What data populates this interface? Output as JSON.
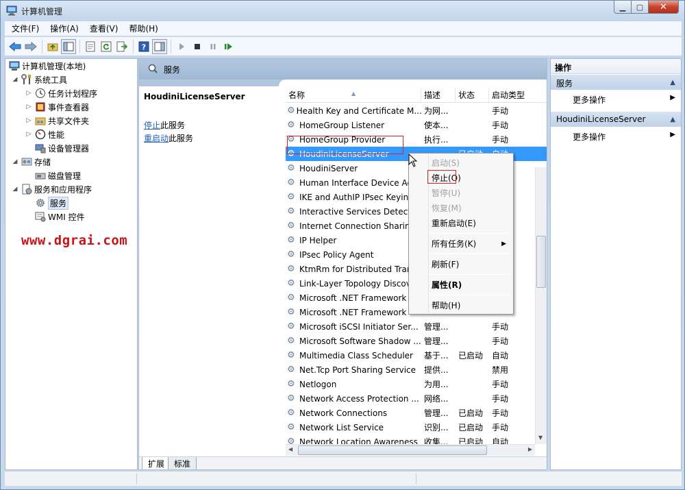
{
  "window": {
    "title": "计算机管理"
  },
  "menu": [
    "文件(F)",
    "操作(A)",
    "查看(V)",
    "帮助(H)"
  ],
  "tree": {
    "root": "计算机管理(本地)",
    "items": [
      {
        "label": "系统工具",
        "level": 1,
        "icon": "tools-icon"
      },
      {
        "label": "任务计划程序",
        "level": 2,
        "icon": "clock-icon"
      },
      {
        "label": "事件查看器",
        "level": 2,
        "icon": "event-viewer-icon"
      },
      {
        "label": "共享文件夹",
        "level": 2,
        "icon": "shared-folder-icon"
      },
      {
        "label": "性能",
        "level": 2,
        "icon": "performance-icon"
      },
      {
        "label": "设备管理器",
        "level": 2,
        "icon": "device-manager-icon"
      },
      {
        "label": "存储",
        "level": 1,
        "icon": "storage-icon"
      },
      {
        "label": "磁盘管理",
        "level": 2,
        "icon": "disk-icon"
      },
      {
        "label": "服务和应用程序",
        "level": 1,
        "icon": "services-apps-icon"
      },
      {
        "label": "服务",
        "level": 2,
        "icon": "gear-icon"
      },
      {
        "label": "WMI 控件",
        "level": 2,
        "icon": "wmi-icon"
      }
    ]
  },
  "watermark": "www.dgrai.com",
  "center": {
    "header": "服务",
    "selected_service": "HoudiniLicenseServer",
    "link_stop": "停止",
    "link_stop_suffix": "此服务",
    "link_restart": "重启动",
    "link_restart_suffix": "此服务",
    "columns": [
      "名称",
      "描述",
      "状态",
      "启动类型"
    ],
    "rows": [
      {
        "name": "Health Key and Certificate M...",
        "desc": "为网...",
        "status": "",
        "start": "手动"
      },
      {
        "name": "HomeGroup Listener",
        "desc": "使本...",
        "status": "",
        "start": "手动"
      },
      {
        "name": "HomeGroup Provider",
        "desc": "执行...",
        "status": "",
        "start": "手动"
      },
      {
        "name": "HoudiniLicenseServer",
        "desc": "",
        "status": "已启动",
        "start": "自动"
      },
      {
        "name": "HoudiniServer",
        "desc": "",
        "status": "",
        "start": ""
      },
      {
        "name": "Human Interface Device Ac",
        "desc": "",
        "status": "",
        "start": ""
      },
      {
        "name": "IKE and AuthIP IPsec Keying",
        "desc": "",
        "status": "",
        "start": ""
      },
      {
        "name": "Interactive Services Detectio",
        "desc": "",
        "status": "",
        "start": ""
      },
      {
        "name": "Internet Connection Sharing",
        "desc": "",
        "status": "",
        "start": ""
      },
      {
        "name": "IP Helper",
        "desc": "",
        "status": "",
        "start": ""
      },
      {
        "name": "IPsec Policy Agent",
        "desc": "",
        "status": "",
        "start": ""
      },
      {
        "name": "KtmRm for Distributed Tran",
        "desc": "",
        "status": "",
        "start": ""
      },
      {
        "name": "Link-Layer Topology Discov",
        "desc": "",
        "status": "",
        "start": ""
      },
      {
        "name": "Microsoft .NET Framework",
        "desc": "",
        "status": "",
        "start": ""
      },
      {
        "name": "Microsoft .NET Framework",
        "desc": "",
        "status": "",
        "start": ""
      },
      {
        "name": "Microsoft iSCSI Initiator Ser...",
        "desc": "管理...",
        "status": "",
        "start": "手动"
      },
      {
        "name": "Microsoft Software Shadow ...",
        "desc": "管理...",
        "status": "",
        "start": "手动"
      },
      {
        "name": "Multimedia Class Scheduler",
        "desc": "基于...",
        "status": "已启动",
        "start": "自动"
      },
      {
        "name": "Net.Tcp Port Sharing Service",
        "desc": "提供...",
        "status": "",
        "start": "禁用"
      },
      {
        "name": "Netlogon",
        "desc": "为用...",
        "status": "",
        "start": "手动"
      },
      {
        "name": "Network Access Protection ...",
        "desc": "网络...",
        "status": "",
        "start": "手动"
      },
      {
        "name": "Network Connections",
        "desc": "管理...",
        "status": "已启动",
        "start": "手动"
      },
      {
        "name": "Network List Service",
        "desc": "识别...",
        "status": "已启动",
        "start": "手动"
      },
      {
        "name": "Network Location Awareness",
        "desc": "收集...",
        "status": "已启动",
        "start": "自动"
      }
    ],
    "tabs": [
      "扩展",
      "标准"
    ]
  },
  "context_menu": {
    "start": "启动(S)",
    "stop": "停止(O)",
    "pause": "暂停(U)",
    "resume": "恢复(M)",
    "restart": "重新启动(E)",
    "all_tasks": "所有任务(K)",
    "refresh": "刷新(F)",
    "properties": "属性(R)",
    "help": "帮助(H)"
  },
  "actions": {
    "title": "操作",
    "section1": "服务",
    "section1_more": "更多操作",
    "section2": "HoudiniLicenseServer",
    "section2_more": "更多操作"
  },
  "colors": {
    "selection": "#3399ff",
    "link": "#1f5fb5",
    "highlight_box": "#e02020",
    "watermark": "#c8141b"
  }
}
